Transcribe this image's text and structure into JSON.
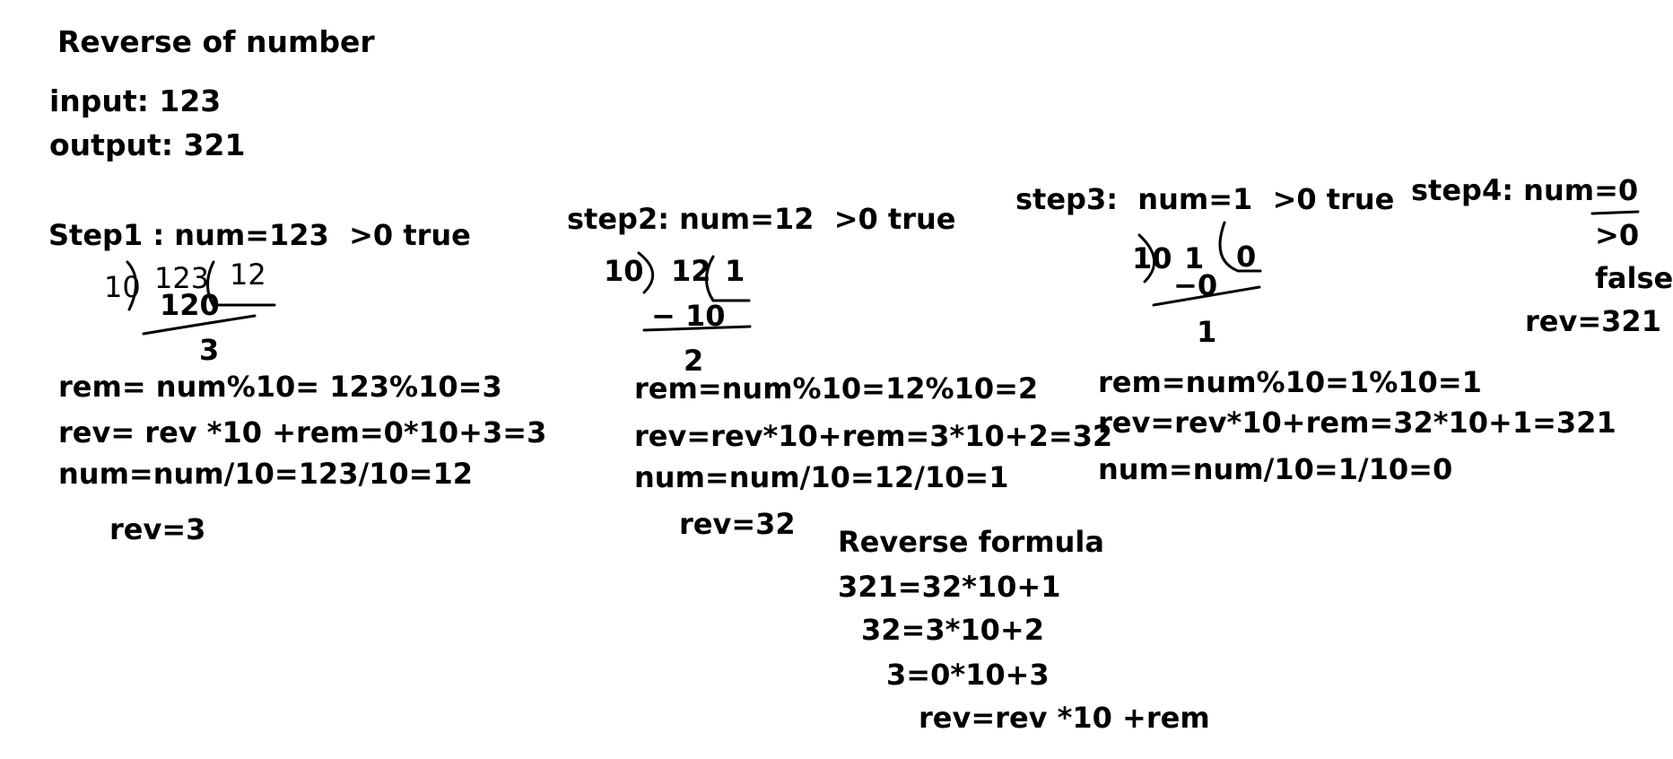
{
  "title": "Reverse of number",
  "io": {
    "input": "input: 123",
    "output": "output: 321"
  },
  "step1": {
    "heading": "Step1 : num=123  >0 true",
    "division": {
      "divisor": "10",
      "dividend": "123",
      "quotient": "12",
      "subtract": "120",
      "remainder": "3"
    },
    "rem": "rem= num%10= 123%10=3",
    "rev": "rev= rev *10 +rem=0*10+3=3",
    "num": "num=num/10=123/10=12",
    "result": "rev=3"
  },
  "step2": {
    "heading": "step2: num=12  >0 true",
    "division": {
      "divisor": "10",
      "dividend": "12",
      "quotient": "1",
      "subtract": "− 10",
      "remainder": "2"
    },
    "rem": "rem=num%10=12%10=2",
    "rev": "rev=rev*10+rem=3*10+2=32",
    "num": "num=num/10=12/10=1",
    "result": "rev=32"
  },
  "step3": {
    "heading": "step3:  num=1  >0 true",
    "division": {
      "divisor": "10",
      "dividend": "1",
      "quotient": "0",
      "subtract": "−0",
      "remainder": "1"
    },
    "rem": "rem=num%10=1%10=1",
    "rev": "rev=rev*10+rem=32*10+1=321",
    "num": "num=num/10=1/10=0"
  },
  "step4": {
    "heading": "step4: num=0",
    "check": ">0",
    "check_result": "false",
    "result": "rev=321"
  },
  "formula": {
    "title": "Reverse formula",
    "lines": [
      "321=32*10+1",
      "32=3*10+2",
      "3=0*10+3",
      "rev=rev *10 +rem"
    ]
  }
}
